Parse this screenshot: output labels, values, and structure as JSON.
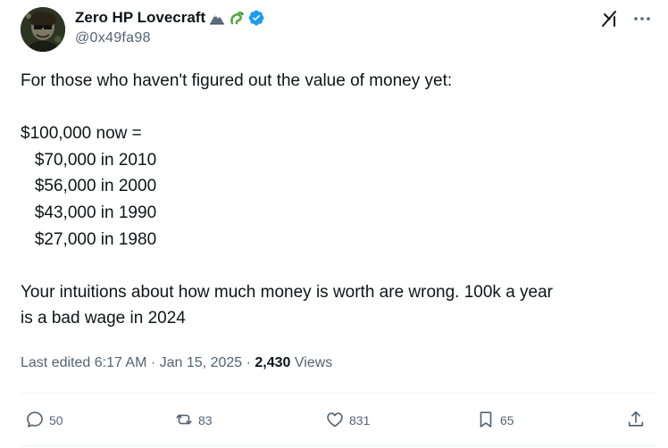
{
  "author": {
    "display_name": "Zero HP Lovecraft",
    "handle": "@0x49fa98",
    "verified": true
  },
  "post": {
    "lines": [
      "For those who haven't figured out the value of money yet:",
      "",
      "$100,000 now =",
      "   $70,000 in 2010",
      "   $56,000 in 2000",
      "   $43,000 in 1990",
      "   $27,000 in 1980",
      "",
      "Your intuitions about how much money is worth are wrong. 100k a year",
      "is a bad wage in 2024"
    ]
  },
  "meta": {
    "edited_label": "Last edited 6:17 AM · Jan 15, 2025 · ",
    "views_count": "2,430",
    "views_label": " Views"
  },
  "actions": {
    "replies": "50",
    "reposts": "83",
    "likes": "831",
    "bookmarks": "65"
  },
  "icons": {
    "verified": "verified-badge-icon",
    "grok": "grok-icon",
    "more": "more-icon",
    "reply": "reply-icon",
    "repost": "repost-icon",
    "like": "heart-icon",
    "bookmark": "bookmark-icon",
    "share": "share-icon"
  },
  "colors": {
    "text": "#0f1419",
    "secondary": "#536471",
    "verified_blue": "#1d9bf0",
    "divider": "#eff3f4"
  }
}
